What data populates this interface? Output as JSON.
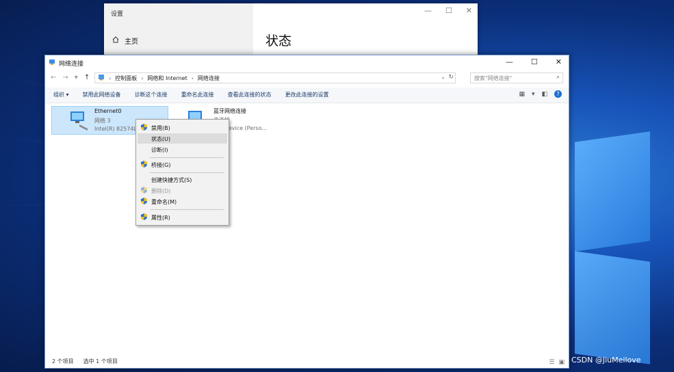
{
  "settings": {
    "title": "设置",
    "home_label": "主页",
    "heading": "状态"
  },
  "explorer": {
    "title": "网络连接",
    "breadcrumb": [
      "控制面板",
      "网络和 Internet",
      "网络连接"
    ],
    "search_placeholder": "搜索\"网络连接\"",
    "toolbar": {
      "organize": "组织 ▾",
      "disable": "禁用此网络设备",
      "diagnose": "诊断这个连接",
      "rename": "重命名此连接",
      "view_status": "查看此连接的状态",
      "change_settings": "更改此连接的设置"
    },
    "items": [
      {
        "name": "Ethernet0",
        "line1": "网络 3",
        "line2": "Intel(R) 82574L"
      },
      {
        "name": "蓝牙网络连接",
        "line1": "未连接",
        "line2": "oth Device (Perso..."
      }
    ],
    "status": {
      "count": "2 个项目",
      "selected": "选中 1 个项目"
    }
  },
  "context_menu": [
    {
      "label": "禁用(B)",
      "shield": true,
      "disabled": false,
      "highlight": false
    },
    {
      "label": "状态(U)",
      "shield": false,
      "disabled": false,
      "highlight": true
    },
    {
      "label": "诊断(I)",
      "shield": false,
      "disabled": false,
      "highlight": false
    },
    {
      "label": "桥接(G)",
      "shield": true,
      "disabled": false,
      "highlight": false
    },
    {
      "label": "创建快捷方式(S)",
      "shield": false,
      "disabled": false,
      "highlight": false
    },
    {
      "label": "删除(D)",
      "shield": true,
      "disabled": true,
      "highlight": false
    },
    {
      "label": "重命名(M)",
      "shield": true,
      "disabled": false,
      "highlight": false
    },
    {
      "label": "属性(R)",
      "shield": true,
      "disabled": false,
      "highlight": false
    }
  ],
  "watermark": "CSDN @JiuMeilove",
  "colors": {
    "accent": "#1e6fd0",
    "selection": "#cce6fb"
  }
}
